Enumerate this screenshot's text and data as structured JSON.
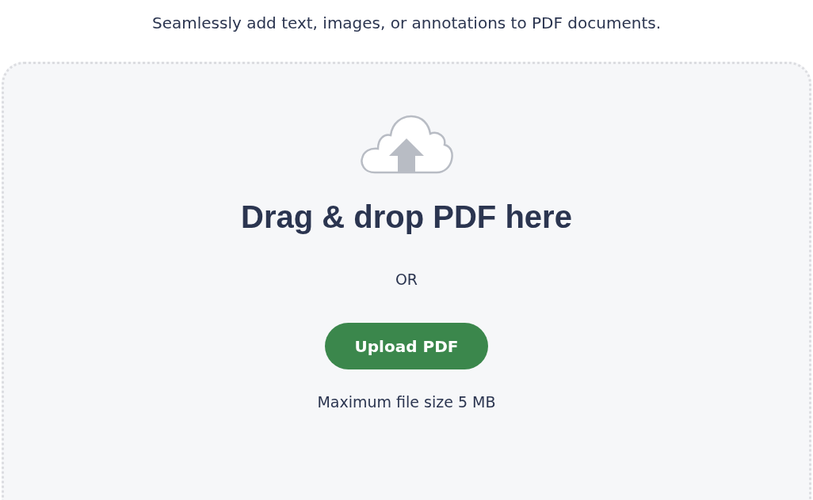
{
  "subtitle": "Seamlessly add text, images, or annotations to PDF documents.",
  "dropzone": {
    "heading": "Drag & drop PDF here",
    "separator": "OR",
    "button": "Upload PDF",
    "note": "Maximum file size 5 MB"
  }
}
